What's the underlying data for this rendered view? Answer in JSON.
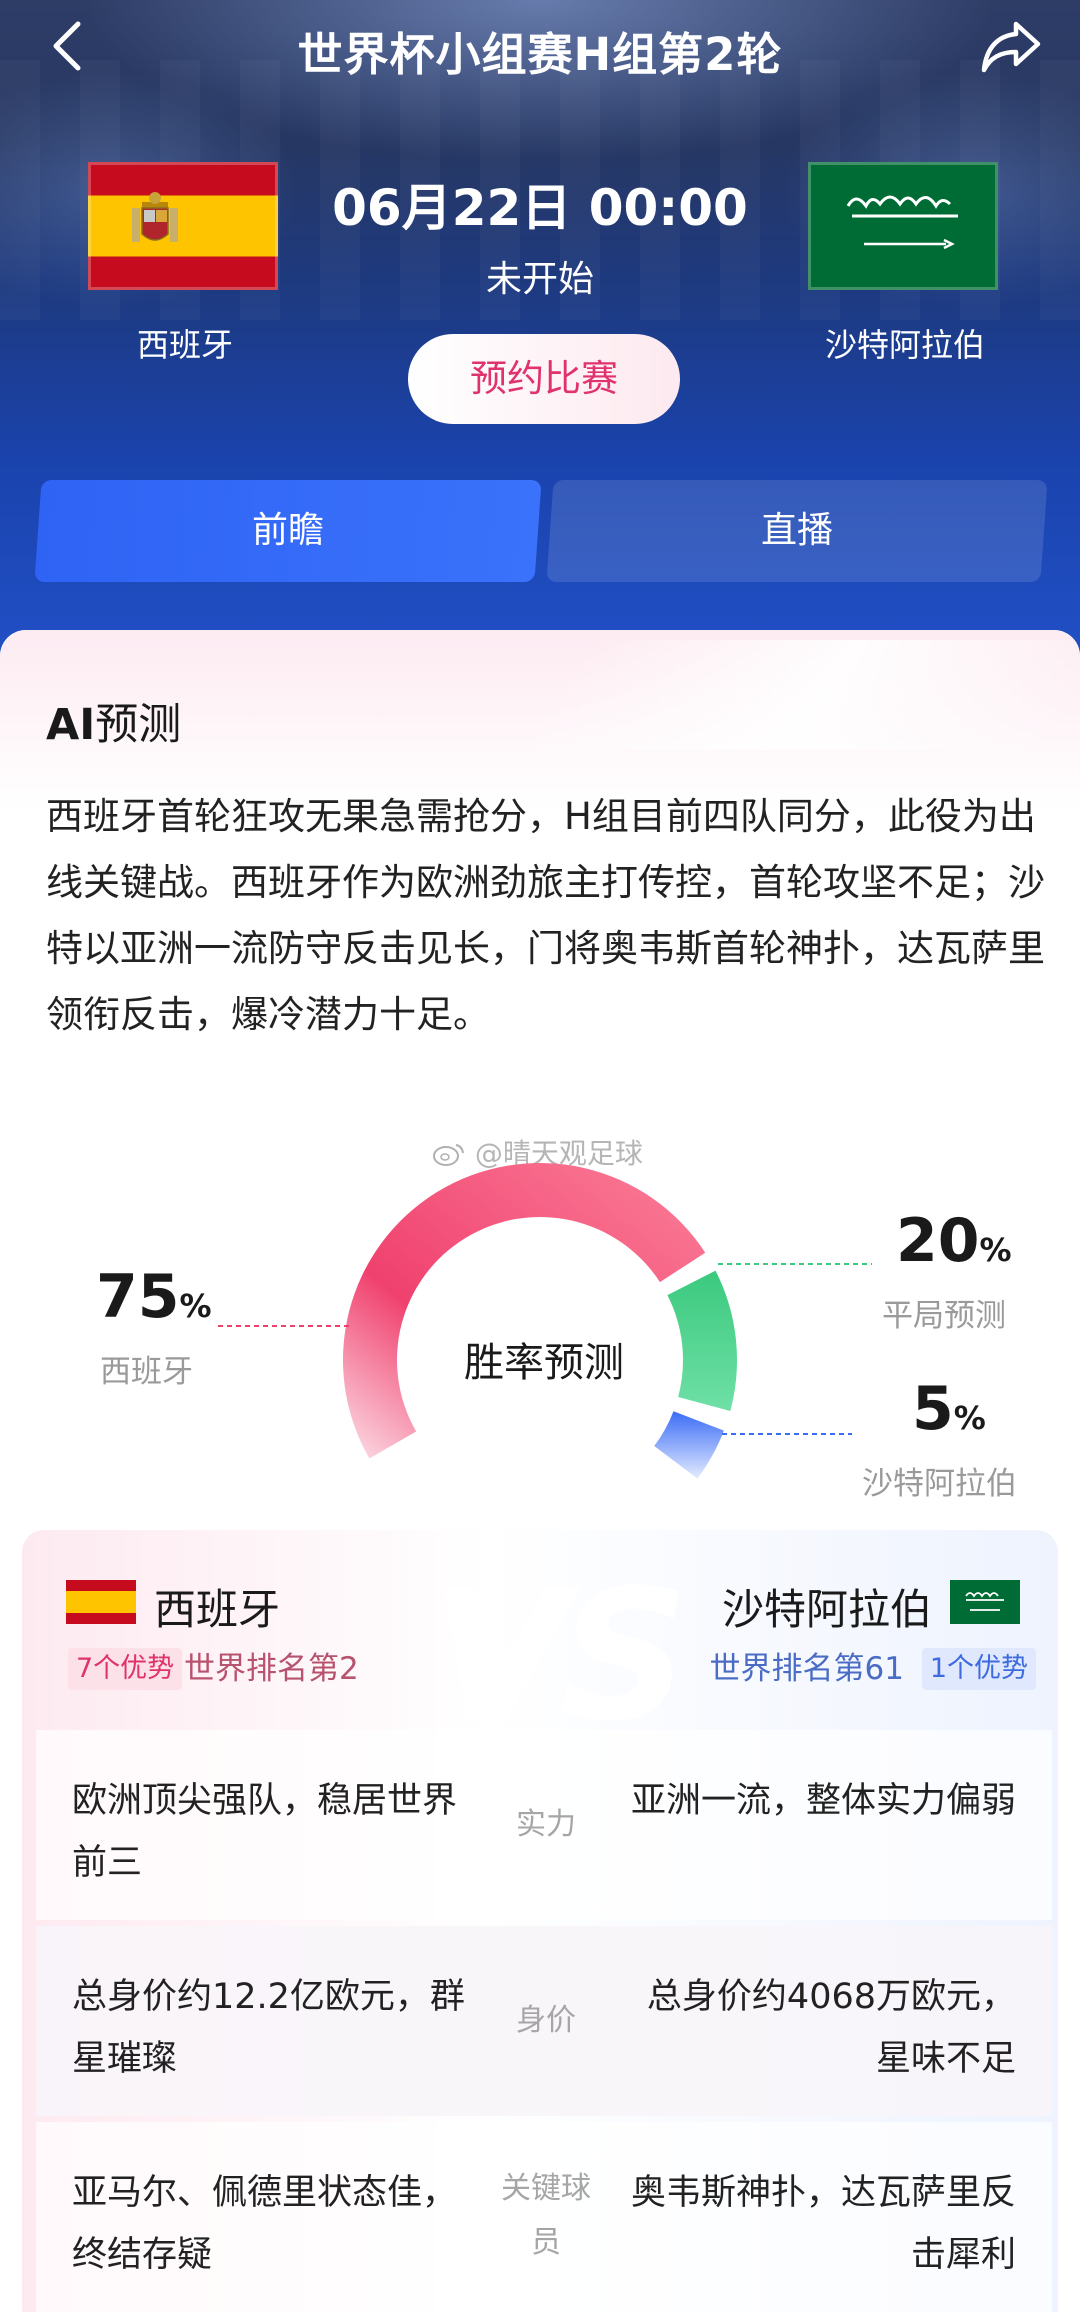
{
  "header": {
    "title": "世界杯小组赛H组第2轮",
    "match_time": "06月22日 00:00",
    "status": "未开始",
    "reserve_label": "预约比赛"
  },
  "teams": {
    "home": {
      "name": "西班牙",
      "flag_colors": [
        "#c60b1e",
        "#ffc400"
      ]
    },
    "away": {
      "name": "沙特阿拉伯",
      "flag_colors": [
        "#006c35",
        "#ffffff"
      ],
      "flag_script": "لا إله إلا الله محمد رسول الله"
    }
  },
  "tabs": [
    {
      "label": "前瞻",
      "active": true
    },
    {
      "label": "直播",
      "active": false
    }
  ],
  "ai": {
    "title_prefix": "AI",
    "title_suffix": "预测",
    "text": "西班牙首轮狂攻无果急需抢分，H组目前四队同分，此役为出线关键战。西班牙作为欧洲劲旅主打传控，首轮攻坚不足；沙特以亚洲一流防守反击见长，门将奥韦斯首轮神扑，达瓦萨里领衔反击，爆冷潜力十足。"
  },
  "watermark": "@晴天观足球",
  "prediction": {
    "center_label": "胜率预测",
    "home": {
      "value": 75,
      "label": "西班牙",
      "color": "#f0416e"
    },
    "draw": {
      "value": 20,
      "label": "平局预测",
      "color": "#3bc97e"
    },
    "away": {
      "value": 5,
      "label": "沙特阿拉伯",
      "color": "#3b6cf6"
    },
    "unit": "%"
  },
  "compare": {
    "vs_text": "VS",
    "home": {
      "name": "西班牙",
      "advantage": "7个优势",
      "rank": "世界排名第2"
    },
    "away": {
      "name": "沙特阿拉伯",
      "advantage": "1个优势",
      "rank": "世界排名第61"
    },
    "rows": [
      {
        "label": "实力",
        "home": "欧洲顶尖强队，稳居世界前三",
        "away": "亚洲一流，整体实力偏弱"
      },
      {
        "label": "身价",
        "home": "总身价约12.2亿欧元，群星璀璨",
        "away": "总身价约4068万欧元，星味不足"
      },
      {
        "label": "关键球员",
        "home": "亚马尔、佩德里状态佳，终结存疑",
        "away": "奥韦斯神扑，达瓦萨里反击犀利"
      }
    ]
  }
}
